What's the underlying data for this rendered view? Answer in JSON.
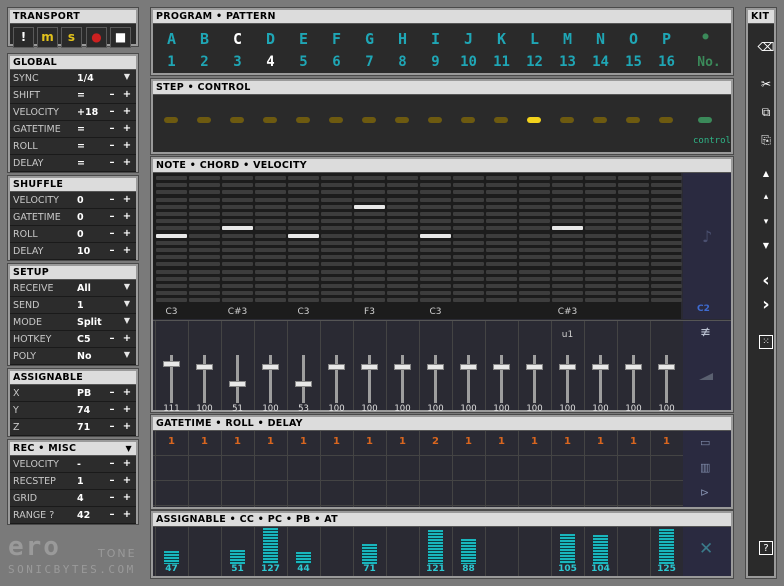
{
  "transport": {
    "title": "TRANSPORT",
    "buttons": [
      {
        "name": "exclaim-button",
        "glyph": "!",
        "color": "#ffffff"
      },
      {
        "name": "seq-m-button",
        "glyph": "m",
        "color": "#e2c21c"
      },
      {
        "name": "seq-s-button",
        "glyph": "s",
        "color": "#e2c21c"
      },
      {
        "name": "record-button",
        "glyph": "●",
        "color": "#cc2020"
      },
      {
        "name": "stop-button",
        "glyph": "■",
        "color": "#ffffff"
      }
    ]
  },
  "global": {
    "title": "GLOBAL",
    "rows": [
      {
        "label": "SYNC",
        "value": "1/4",
        "control": "select"
      },
      {
        "label": "SHIFT",
        "value": "=",
        "control": "stepper"
      },
      {
        "label": "VELOCITY",
        "value": "+18",
        "control": "stepper"
      },
      {
        "label": "GATETIME",
        "value": "=",
        "control": "stepper"
      },
      {
        "label": "ROLL",
        "value": "=",
        "control": "stepper"
      },
      {
        "label": "DELAY",
        "value": "=",
        "control": "stepper"
      }
    ]
  },
  "shuffle": {
    "title": "SHUFFLE",
    "rows": [
      {
        "label": "VELOCITY",
        "value": "0",
        "control": "stepper"
      },
      {
        "label": "GATETIME",
        "value": "0",
        "control": "stepper"
      },
      {
        "label": "ROLL",
        "value": "0",
        "control": "stepper"
      },
      {
        "label": "DELAY",
        "value": "10",
        "control": "stepper"
      }
    ]
  },
  "setup": {
    "title": "SETUP",
    "rows": [
      {
        "label": "RECEIVE",
        "value": "All",
        "control": "select"
      },
      {
        "label": "SEND",
        "value": "1",
        "control": "select"
      },
      {
        "label": "MODE",
        "value": "Split",
        "control": "select"
      },
      {
        "label": "HOTKEY",
        "value": "C5",
        "control": "stepper"
      },
      {
        "label": "POLY",
        "value": "No",
        "control": "select"
      }
    ]
  },
  "assignable_left": {
    "title": "ASSIGNABLE",
    "rows": [
      {
        "label": "X",
        "value": "PB",
        "control": "stepper"
      },
      {
        "label": "Y",
        "value": "74",
        "control": "stepper"
      },
      {
        "label": "Z",
        "value": "71",
        "control": "stepper"
      }
    ]
  },
  "rec_misc": {
    "title": "REC • MISC",
    "rows": [
      {
        "label": "VELOCITY",
        "value": "-",
        "control": "stepper"
      },
      {
        "label": "RECSTEP",
        "value": "1",
        "control": "stepper"
      },
      {
        "label": "GRID",
        "value": "4",
        "control": "stepper"
      },
      {
        "label": "RANGE ?",
        "value": "42",
        "control": "stepper"
      }
    ]
  },
  "logo": {
    "brand": "ero",
    "tone": "TONE",
    "site": "SONICBYTES.COM"
  },
  "program_pattern": {
    "title": "PROGRAM • PATTERN",
    "letters": [
      "A",
      "B",
      "C",
      "D",
      "E",
      "F",
      "G",
      "H",
      "I",
      "J",
      "K",
      "L",
      "M",
      "N",
      "O",
      "P"
    ],
    "numbers": [
      "1",
      "2",
      "3",
      "4",
      "5",
      "6",
      "7",
      "8",
      "9",
      "10",
      "11",
      "12",
      "13",
      "14",
      "15",
      "16"
    ],
    "selected_letter": "C",
    "selected_number": "4",
    "no_label": "No.",
    "dot_label": "●"
  },
  "step_control": {
    "title": "STEP • CONTROL",
    "active_step": 12,
    "control_label": "control"
  },
  "note_chord_velocity": {
    "title": "NOTE • CHORD • VELOCITY",
    "notes": [
      "C3",
      "",
      "C#3",
      "",
      "C3",
      "",
      "F3",
      "",
      "C3",
      "",
      "",
      "",
      "C#3",
      "",
      "",
      ""
    ],
    "note_rows": [
      7,
      0,
      6,
      0,
      7,
      0,
      3,
      0,
      7,
      0,
      0,
      0,
      6,
      0,
      0,
      0
    ],
    "side_label": "C2",
    "chord_label": "u1",
    "velocities": [
      111,
      100,
      51,
      100,
      53,
      100,
      100,
      100,
      100,
      100,
      100,
      100,
      100,
      100,
      100,
      100
    ]
  },
  "gatetime_roll_delay": {
    "title": "GATETIME • ROLL • DELAY",
    "values": [
      "1",
      "1",
      "1",
      "1",
      "1",
      "1",
      "1",
      "1",
      "2",
      "1",
      "1",
      "1",
      "1",
      "1",
      "1",
      "1"
    ]
  },
  "assignable_cc": {
    "title": "ASSIGNABLE • CC • PC • PB • AT",
    "values": [
      47,
      null,
      51,
      127,
      44,
      null,
      71,
      null,
      121,
      88,
      null,
      null,
      105,
      104,
      null,
      125
    ],
    "max": 127,
    "clear_label": "✕"
  },
  "kit": {
    "title": "KIT",
    "icons": [
      "trash-icon",
      "cut-icon",
      "copy-icon",
      "paste-icon",
      "shift-up-icon",
      "nudge-up-icon",
      "nudge-down-icon",
      "shift-down-icon",
      "shift-left-icon",
      "shift-right-icon",
      "randomize-icon",
      "help-icon"
    ]
  }
}
